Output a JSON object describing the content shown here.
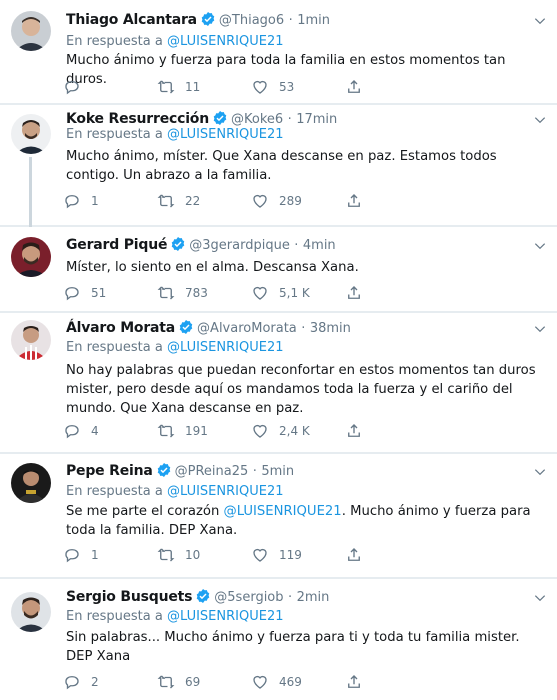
{
  "tweets": [
    {
      "name": "Thiago Alcantara",
      "handle": "@Thiago6",
      "time": "1min",
      "reply_prefix": "En respuesta a",
      "reply_to": "@LUISENRIQUE21",
      "text": "Mucho ánimo y fuerza para toda la familia en estos momentos tan duros.",
      "replies": "",
      "retweets": "11",
      "likes": "53"
    },
    {
      "name": "Koke Resurrección",
      "handle": "@Koke6",
      "time": "17min",
      "reply_prefix": "En respuesta a",
      "reply_to": "@LUISENRIQUE21",
      "text": "Mucho ánimo, míster. Que Xana descanse en paz. Estamos todos contigo. Un abrazo a la familia.",
      "replies": "1",
      "retweets": "22",
      "likes": "289"
    },
    {
      "name": "Gerard Piqué",
      "handle": "@3gerardpique",
      "time": "4min",
      "text": "Míster, lo siento en el alma. Descansa Xana.",
      "replies": "51",
      "retweets": "783",
      "likes": "5,1 K"
    },
    {
      "name": "Álvaro Morata",
      "handle": "@AlvaroMorata",
      "time": "38min",
      "reply_prefix": "En respuesta a",
      "reply_to": "@LUISENRIQUE21",
      "text": "No hay palabras que puedan reconfortar en estos momentos tan duros mister, pero desde aquí os mandamos toda la fuerza y el cariño del mundo. Que Xana descanse en paz.",
      "replies": "4",
      "retweets": "191",
      "likes": "2,4 K"
    },
    {
      "name": "Pepe Reina",
      "handle": "@PReina25",
      "time": "5min",
      "reply_prefix": "En respuesta a",
      "reply_to": "@LUISENRIQUE21",
      "text_before": "Se me parte el corazón ",
      "text_mention": "@LUISENRIQUE21",
      "text_after": ". Mucho ánimo y fuerza para toda la familia. DEP Xana.",
      "replies": "1",
      "retweets": "10",
      "likes": "119"
    },
    {
      "name": "Sergio Busquets",
      "handle": "@5sergiob",
      "time": "2min",
      "reply_prefix": "En respuesta a",
      "reply_to": "@LUISENRIQUE21",
      "text": "Sin palabras... Mucho ánimo y fuerza para ti y toda tu familia mister. DEP Xana",
      "replies": "2",
      "retweets": "69",
      "likes": "469"
    }
  ],
  "colors": {
    "link": "#1b95e0",
    "verified": "#1da1f2",
    "secondary": "#657786",
    "thread_line": "#ccd6dd"
  },
  "icons": [
    "reply-icon",
    "retweet-icon",
    "like-icon",
    "share-icon",
    "verified-icon",
    "caret-down-icon"
  ]
}
